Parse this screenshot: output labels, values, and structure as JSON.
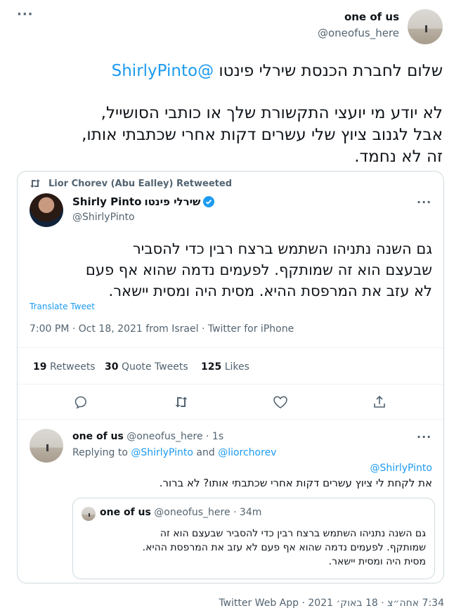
{
  "top_tweet": {
    "author_name": "one of us",
    "author_handle": "@oneofus_here",
    "line1_text": "שלום לחברת הכנסת שירלי פינטו ",
    "line1_mention": "@ShirlyPinto",
    "paragraph": [
      "לא יודע מי יועצי התקשורת שלך או כותבי הסושייל,",
      "אבל לגנוב ציוץ שלי עשרים דקות אחרי שכתבתי אותו,",
      "זה לא נחמד."
    ],
    "footer": "7:34 אחה״צ · 18 באוק׳ 2021 · Twitter Web App"
  },
  "embedded": {
    "retweeted_by": "Lior Chorev (Abu Ealley) Retweeted",
    "author_name_en": "Shirly Pinto",
    "author_name_he": "שירלי פינטו",
    "author_handle": "@ShirlyPinto",
    "lines": [
      "גם השנה נתניהו השתמש ברצח רבין כדי להסביר",
      "שבעצם הוא זה שמותקף. לפעמים נדמה שהוא אף פעם",
      "לא עזב את המרפסת ההיא. מסית היה ומסית יישאר."
    ],
    "translate": "Translate Tweet",
    "meta": "7:00 PM · Oct 18, 2021 from Israel · Twitter for iPhone",
    "stats": {
      "retweets_count": "19",
      "retweets_label": "Retweets",
      "quotes_count": "30",
      "quotes_label": "Quote Tweets",
      "likes_count": "125",
      "likes_label": "Likes"
    }
  },
  "reply": {
    "author_name": "one of us",
    "author_handle_time": "@oneofus_here · 1s",
    "replying_prefix": "Replying to",
    "replying_user1": "@ShirlyPinto",
    "replying_and": "and",
    "replying_user2": "@liorchorev",
    "mention": "@ShirlyPinto",
    "text": "את לקחת לי ציוץ עשרים דקות אחרי שכתבתי אותו? לא ברור.",
    "quote": {
      "author_name": "one of us",
      "author_handle_time": "@oneofus_here · 34m",
      "lines": [
        "גם השנה נתניהו השתמש ברצח רבין כדי להסביר שבעצם הוא זה",
        "שמותקף. לפעמים נדמה שהוא אף פעם לא עזב את המרפסת ההיא.",
        "מסית היה ומסית יישאר."
      ]
    }
  },
  "icons": [
    "more-dots-icon",
    "retweet-icon",
    "verified-badge-icon",
    "reply-icon",
    "like-icon",
    "share-icon"
  ]
}
